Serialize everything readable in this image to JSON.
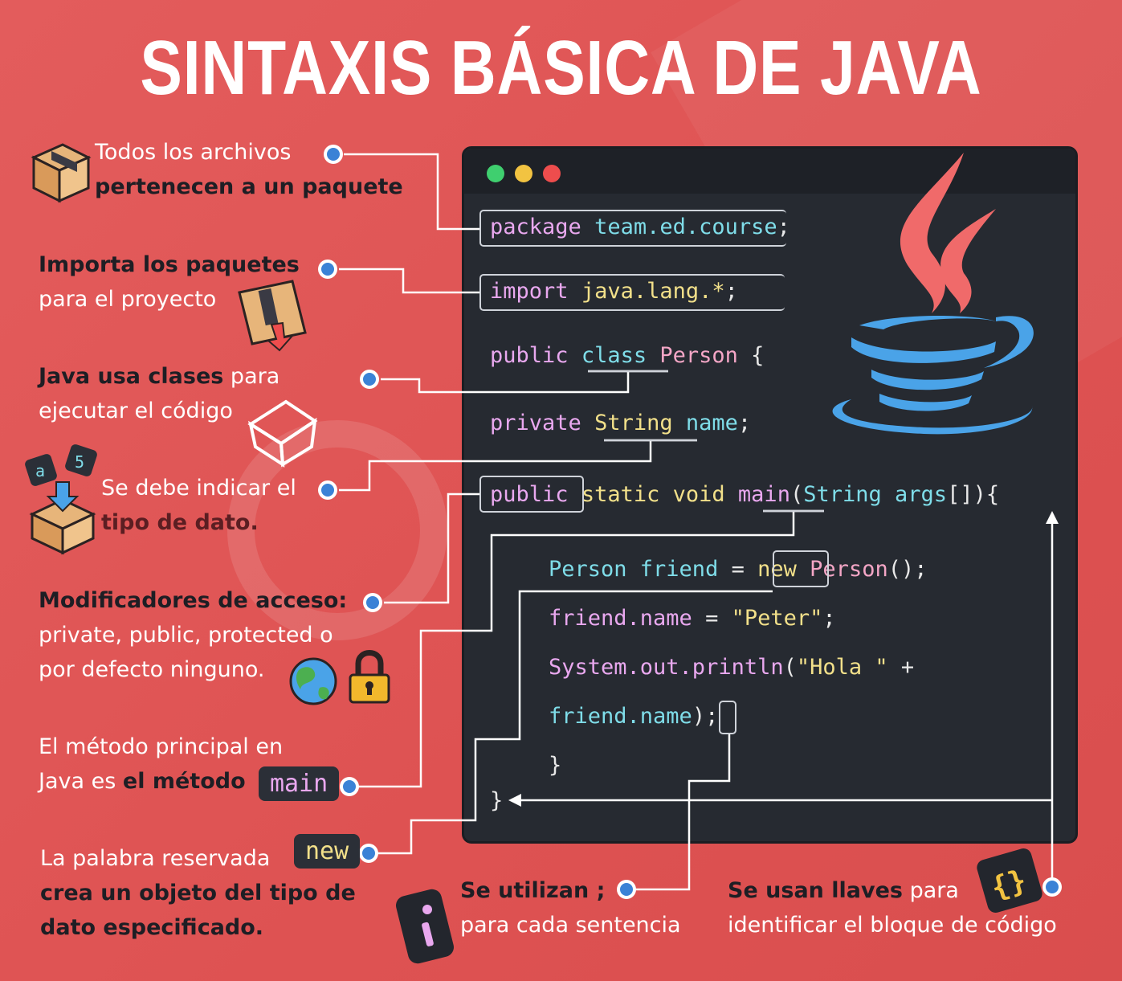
{
  "title": "SINTAXIS BÁSICA DE JAVA",
  "labels": {
    "package_l1": "Todos los archivos",
    "package_l2": "pertenecen a un paquete",
    "import_l1": "Importa los paquetes",
    "import_l2": "para el proyecto",
    "class_bold": "Java usa clases",
    "class_rest": " para",
    "class_l2": "ejecutar el código",
    "type_l1": "Se debe indicar el",
    "type_l2": "tipo de dato.",
    "mod_l1": "Modificadores de acceso:",
    "mod_l2": "private, public, protected o",
    "mod_l3": "por defecto ninguno.",
    "main_l1": "El método principal en",
    "main_l2a": "Java es ",
    "main_l2b": "el método",
    "main_chip": "main",
    "new_l1": "La palabra reservada",
    "new_chip": "new",
    "new_l2": "crea un objeto del tipo de",
    "new_l3": "dato especificado.",
    "semi_l1": "Se utilizan ;",
    "semi_l2": "para cada sentencia",
    "brace_bold": "Se usan llaves",
    "brace_rest": " para",
    "brace_l2": "identificar el bloque de código"
  },
  "code": {
    "l1_kw": "package",
    "l1_val": "team.ed.course",
    "l1_end": ";",
    "l2_kw": "import",
    "l2_val": "java.lang.*",
    "l2_end": ";",
    "l3_kw": "public",
    "l3_cls": "class",
    "l3_name": "Person",
    "l3_end": "{",
    "l4_kw": "private",
    "l4_type": "String",
    "l4_name": "name",
    "l4_end": ";",
    "l5_kw": "public",
    "l5_static": "static",
    "l5_void": "void",
    "l5_main": "main",
    "l5_p1": "(",
    "l5_type": "String",
    "l5_args": "args",
    "l5_end": "[]){",
    "l6_a": "Person friend",
    "l6_eq": "=",
    "l6_new": "new",
    "l6_b": "Person",
    "l6_end": "();",
    "l7_a": "friend.name",
    "l7_eq": " = ",
    "l7_str": "\"Peter\"",
    "l7_end": ";",
    "l8_a": "System.out.println",
    "l8_p": "(",
    "l8_str": "\"Hola \"",
    "l8_plus": " +",
    "l9_a": "friend.name",
    "l9_p": ")",
    "l9_end": ";",
    "l10": "}",
    "l11": "}"
  },
  "icons": [
    "package-box-icon",
    "import-box-icon",
    "cube-icon",
    "data-type-box-icon",
    "globe-icon",
    "padlock-icon",
    "info-icon",
    "braces-icon",
    "java-logo-icon"
  ],
  "colors": {
    "background": "#e05555",
    "editor": "#262a31",
    "keyword": "#e9a8ef",
    "identifier": "#7fdde9",
    "string": "#f2e08a",
    "java_cup": "#4aa3e8",
    "java_steam": "#f06a6a"
  }
}
